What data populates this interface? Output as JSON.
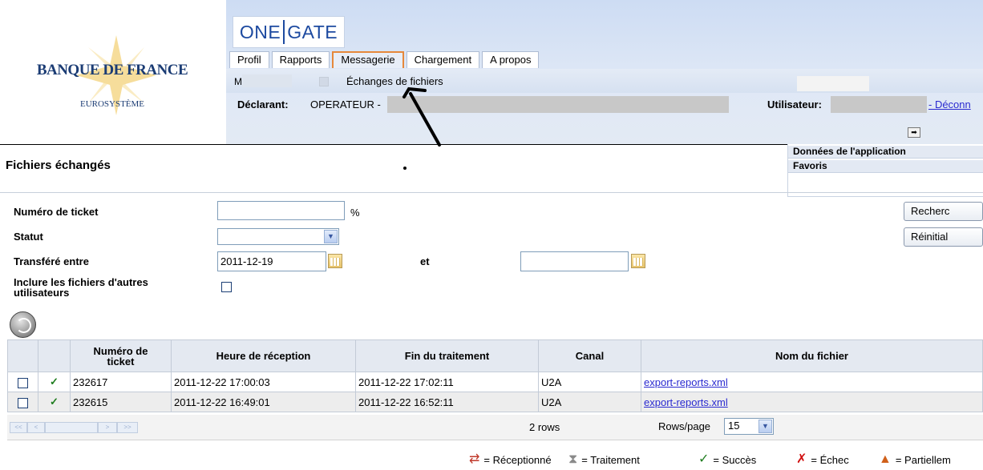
{
  "header": {
    "bank_name": "BANQUE DE FRANCE",
    "bank_subtitle": "EUROSYSTÈME",
    "app_name_left": "ONE",
    "app_name_right": "GATE",
    "tabs": [
      {
        "label": "Profil"
      },
      {
        "label": "Rapports"
      },
      {
        "label": "Messagerie"
      },
      {
        "label": "Chargement"
      },
      {
        "label": "A propos"
      }
    ],
    "subnav": {
      "left_item": "M",
      "active_item": "Échanges de fichiers"
    },
    "declarant_label": "Déclarant:",
    "declarant_value": "OPERATEUR -",
    "user_label": "Utilisateur:",
    "logout_link": "- Déconn"
  },
  "side_panel": {
    "items": [
      {
        "label": "Données de l'application"
      },
      {
        "label": "Favoris"
      }
    ]
  },
  "page": {
    "title": "Fichiers échangés"
  },
  "form": {
    "ticket_label": "Numéro de ticket",
    "ticket_value": "",
    "percent": "%",
    "status_label": "Statut",
    "status_value": "",
    "transfer_label": "Transféré entre",
    "date_from": "2011-12-19",
    "and_label": "et",
    "date_to": "",
    "include_label_line1": "Inclure les fichiers d'autres",
    "include_label_line2": "utilisateurs",
    "search_button": "Recherc",
    "reset_button": "Réinitial"
  },
  "table": {
    "columns": [
      "",
      "",
      "Numéro de ticket",
      "Heure de réception",
      "Fin du traitement",
      "Canal",
      "Nom du fichier"
    ],
    "rows": [
      {
        "status": "✓",
        "ticket": "232617",
        "received": "2011-12-22 17:00:03",
        "finished": "2011-12-22 17:02:11",
        "channel": "U2A",
        "file": "export-reports.xml"
      },
      {
        "status": "✓",
        "ticket": "232615",
        "received": "2011-12-22 16:49:01",
        "finished": "2011-12-22 16:52:11",
        "channel": "U2A",
        "file": "export-reports.xml"
      }
    ],
    "row_count": "2 rows",
    "rows_per_page_label": "Rows/page",
    "rows_per_page_value": "15",
    "pager": [
      "<<",
      "<",
      ">",
      ">>"
    ]
  },
  "legend": [
    {
      "icon": "received-icon",
      "glyph": "⇄",
      "color": "#c0392b",
      "label": "= Réceptionné"
    },
    {
      "icon": "hourglass-icon",
      "glyph": "⧗",
      "color": "#8a8a8a",
      "label": "= Traitement"
    },
    {
      "icon": "check-icon",
      "glyph": "✓",
      "color": "#1f7d1f",
      "label": "= Succès"
    },
    {
      "icon": "cross-icon",
      "glyph": "✗",
      "color": "#d01010",
      "label": "= Échec"
    },
    {
      "icon": "warning-icon",
      "glyph": "▲",
      "color": "#d0601a",
      "label": "= Partiellem"
    }
  ],
  "colors": {
    "accent_tab": "#e6883b",
    "link": "#2a2ad0",
    "header_blue": "#cddcf3"
  }
}
